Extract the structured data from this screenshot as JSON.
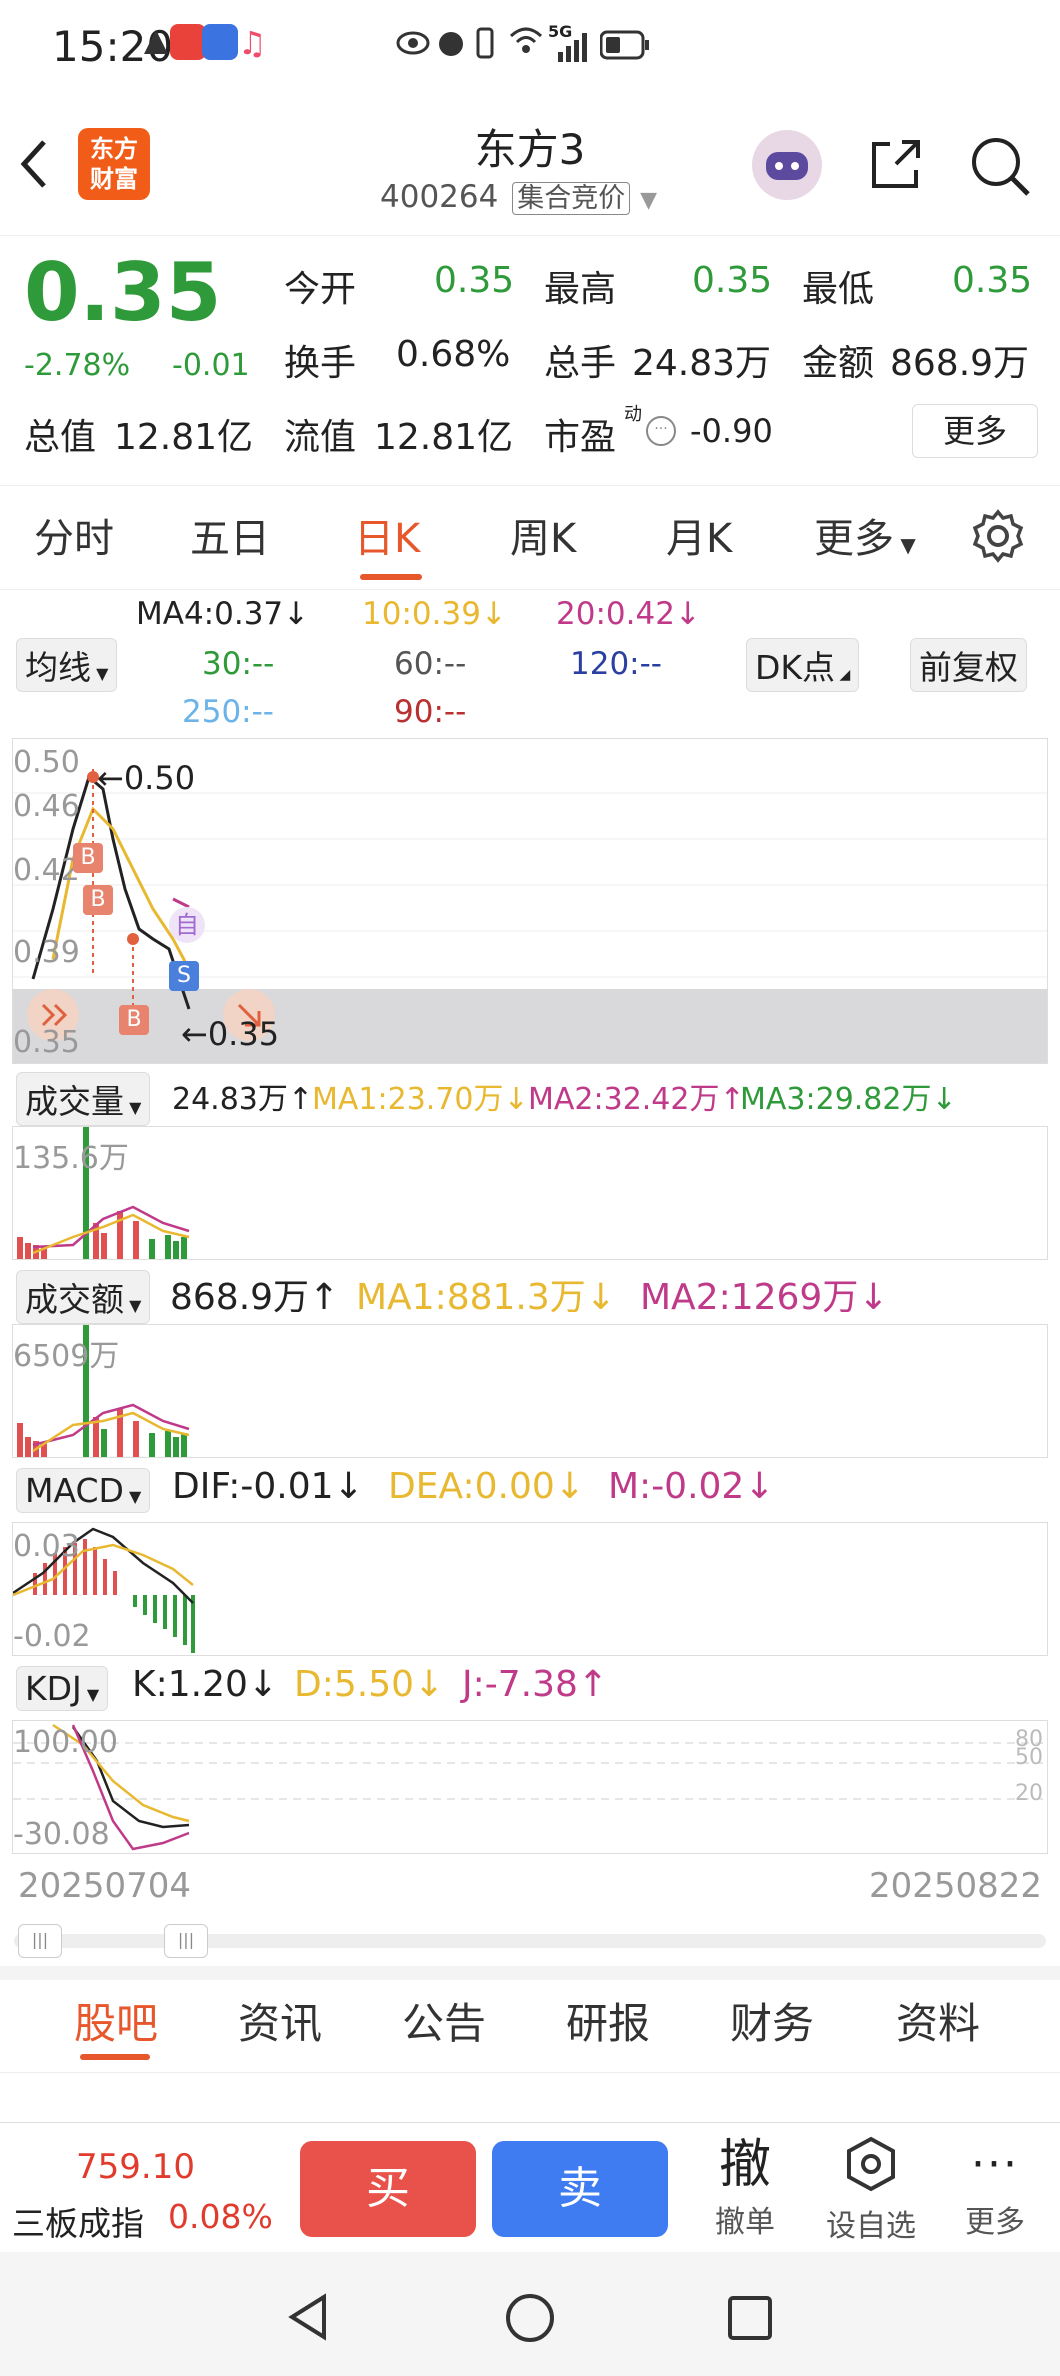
{
  "status": {
    "time": "15:20",
    "signal": "5G"
  },
  "header": {
    "logo_line1": "东方",
    "logo_line2": "财富",
    "title": "东方3",
    "code": "400264",
    "auction": "集合竞价"
  },
  "quote": {
    "price": "0.35",
    "change_pct": "-2.78%",
    "change": "-0.01",
    "open_label": "今开",
    "open": "0.35",
    "high_label": "最高",
    "high": "0.35",
    "low_label": "最低",
    "low": "0.35",
    "turnover_label": "换手",
    "turnover": "0.68%",
    "volume_label": "总手",
    "volume": "24.83万",
    "amount_label": "金额",
    "amount": "868.9万",
    "mktcap_label": "总值",
    "mktcap": "12.81亿",
    "float_label": "流值",
    "float": "12.81亿",
    "pe_label": "市盈",
    "pe_sup": "动",
    "pe": "-0.90",
    "more": "更多"
  },
  "tabs": [
    "分时",
    "五日",
    "日K",
    "周K",
    "月K",
    "更多"
  ],
  "ma_panel": {
    "select": "均线",
    "ma4": "MA4:0.37↓",
    "ma10": "10:0.39↓",
    "ma20": "20:0.42↓",
    "ma30": "30:--",
    "ma60": "60:--",
    "ma120": "120:--",
    "ma250": "250:--",
    "ma90": "90:--",
    "dk": "DK点",
    "fq": "前复权"
  },
  "kchart": {
    "y_labels": [
      "0.50",
      "0.46",
      "0.42",
      "0.39",
      "0.35"
    ],
    "high_mark": "←0.50",
    "low_mark": "←0.35",
    "markers": [
      "B",
      "B",
      "B",
      "S",
      "自"
    ]
  },
  "vol": {
    "select": "成交量",
    "value": "24.83万↑",
    "ma1": "MA1:23.70万↓",
    "ma2": "MA2:32.42万↑",
    "ma3": "MA3:29.82万↓",
    "axis": "135.6万"
  },
  "amt": {
    "select": "成交额",
    "value": "868.9万↑",
    "ma1": "MA1:881.3万↓",
    "ma2": "MA2:1269万↓",
    "axis": "6509万"
  },
  "macd": {
    "select": "MACD",
    "dif": "DIF:-0.01↓",
    "dea": "DEA:0.00↓",
    "m": "M:-0.02↓",
    "top": "0.03",
    "bottom": "-0.02"
  },
  "kdj": {
    "select": "KDJ",
    "k": "K:1.20↓",
    "d": "D:5.50↓",
    "j": "J:-7.38↑",
    "top": "100.00",
    "bottom": "-30.08",
    "lv80": "80",
    "lv50": "50",
    "lv20": "20"
  },
  "dates": {
    "start": "20250704",
    "end": "20250822"
  },
  "bottom_tabs": [
    "股吧",
    "资讯",
    "公告",
    "研报",
    "财务",
    "资料"
  ],
  "bottom_bar": {
    "index_value": "759.10",
    "index_name": "三板成指",
    "index_pct": "0.08%",
    "buy": "买",
    "sell": "卖",
    "cancel_icon_text": "撤",
    "cancel_label": "撤单",
    "watch_label": "设自选",
    "more_label": "更多"
  },
  "colors": {
    "red": "#e03b2d",
    "green": "#2f9a3a",
    "brand": "#f25c19",
    "buy": "#e8524a",
    "sell": "#3f7cf2"
  }
}
